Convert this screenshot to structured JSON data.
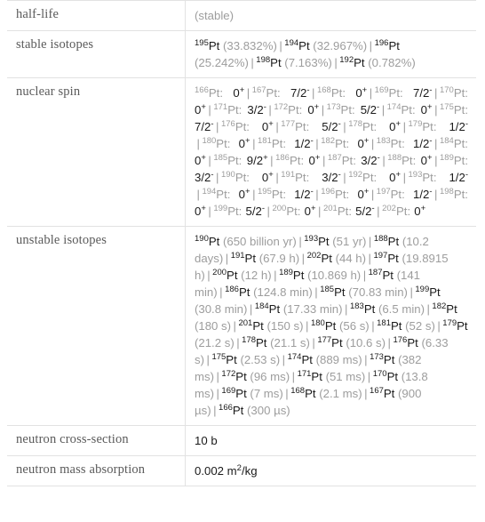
{
  "table": {
    "rows": [
      {
        "label": "half-life",
        "kind": "simple",
        "value": "(stable)",
        "value_style": "muted"
      },
      {
        "label": "stable isotopes",
        "kind": "isotope_list",
        "items": [
          {
            "mass": "195",
            "symbol": "Pt",
            "detail": "(33.832%)"
          },
          {
            "mass": "194",
            "symbol": "Pt",
            "detail": "(32.967%)"
          },
          {
            "mass": "196",
            "symbol": "Pt",
            "detail": "(25.242%)"
          },
          {
            "mass": "198",
            "symbol": "Pt",
            "detail": "(7.163%)"
          },
          {
            "mass": "192",
            "symbol": "Pt",
            "detail": "(0.782%)"
          }
        ]
      },
      {
        "label": "nuclear spin",
        "kind": "spin_list",
        "items": [
          {
            "mass": "166",
            "symbol": "Pt",
            "spin": "0",
            "spin_sup": "+"
          },
          {
            "mass": "167",
            "symbol": "Pt",
            "spin": "7/2",
            "spin_sup": "-"
          },
          {
            "mass": "168",
            "symbol": "Pt",
            "spin": "0",
            "spin_sup": "+"
          },
          {
            "mass": "169",
            "symbol": "Pt",
            "spin": "7/2",
            "spin_sup": "-"
          },
          {
            "mass": "170",
            "symbol": "Pt",
            "spin": "0",
            "spin_sup": "+"
          },
          {
            "mass": "171",
            "symbol": "Pt",
            "spin": "3/2",
            "spin_sup": "-"
          },
          {
            "mass": "172",
            "symbol": "Pt",
            "spin": "0",
            "spin_sup": "+"
          },
          {
            "mass": "173",
            "symbol": "Pt",
            "spin": "5/2",
            "spin_sup": "-"
          },
          {
            "mass": "174",
            "symbol": "Pt",
            "spin": "0",
            "spin_sup": "+"
          },
          {
            "mass": "175",
            "symbol": "Pt",
            "spin": "7/2",
            "spin_sup": "-"
          },
          {
            "mass": "176",
            "symbol": "Pt",
            "spin": "0",
            "spin_sup": "+"
          },
          {
            "mass": "177",
            "symbol": "Pt",
            "spin": "5/2",
            "spin_sup": "-"
          },
          {
            "mass": "178",
            "symbol": "Pt",
            "spin": "0",
            "spin_sup": "+"
          },
          {
            "mass": "179",
            "symbol": "Pt",
            "spin": "1/2",
            "spin_sup": "-"
          },
          {
            "mass": "180",
            "symbol": "Pt",
            "spin": "0",
            "spin_sup": "+"
          },
          {
            "mass": "181",
            "symbol": "Pt",
            "spin": "1/2",
            "spin_sup": "-"
          },
          {
            "mass": "182",
            "symbol": "Pt",
            "spin": "0",
            "spin_sup": "+"
          },
          {
            "mass": "183",
            "symbol": "Pt",
            "spin": "1/2",
            "spin_sup": "-"
          },
          {
            "mass": "184",
            "symbol": "Pt",
            "spin": "0",
            "spin_sup": "+"
          },
          {
            "mass": "185",
            "symbol": "Pt",
            "spin": "9/2",
            "spin_sup": "+"
          },
          {
            "mass": "186",
            "symbol": "Pt",
            "spin": "0",
            "spin_sup": "+"
          },
          {
            "mass": "187",
            "symbol": "Pt",
            "spin": "3/2",
            "spin_sup": "-"
          },
          {
            "mass": "188",
            "symbol": "Pt",
            "spin": "0",
            "spin_sup": "+"
          },
          {
            "mass": "189",
            "symbol": "Pt",
            "spin": "3/2",
            "spin_sup": "-"
          },
          {
            "mass": "190",
            "symbol": "Pt",
            "spin": "0",
            "spin_sup": "+"
          },
          {
            "mass": "191",
            "symbol": "Pt",
            "spin": "3/2",
            "spin_sup": "-"
          },
          {
            "mass": "192",
            "symbol": "Pt",
            "spin": "0",
            "spin_sup": "+"
          },
          {
            "mass": "193",
            "symbol": "Pt",
            "spin": "1/2",
            "spin_sup": "-"
          },
          {
            "mass": "194",
            "symbol": "Pt",
            "spin": "0",
            "spin_sup": "+"
          },
          {
            "mass": "195",
            "symbol": "Pt",
            "spin": "1/2",
            "spin_sup": "-"
          },
          {
            "mass": "196",
            "symbol": "Pt",
            "spin": "0",
            "spin_sup": "+"
          },
          {
            "mass": "197",
            "symbol": "Pt",
            "spin": "1/2",
            "spin_sup": "-"
          },
          {
            "mass": "198",
            "symbol": "Pt",
            "spin": "0",
            "spin_sup": "+"
          },
          {
            "mass": "199",
            "symbol": "Pt",
            "spin": "5/2",
            "spin_sup": "-"
          },
          {
            "mass": "200",
            "symbol": "Pt",
            "spin": "0",
            "spin_sup": "+"
          },
          {
            "mass": "201",
            "symbol": "Pt",
            "spin": "5/2",
            "spin_sup": "-"
          },
          {
            "mass": "202",
            "symbol": "Pt",
            "spin": "0",
            "spin_sup": "+"
          }
        ]
      },
      {
        "label": "unstable isotopes",
        "kind": "isotope_list",
        "items": [
          {
            "mass": "190",
            "symbol": "Pt",
            "detail": "(650 billion yr)"
          },
          {
            "mass": "193",
            "symbol": "Pt",
            "detail": "(51 yr)"
          },
          {
            "mass": "188",
            "symbol": "Pt",
            "detail": "(10.2 days)"
          },
          {
            "mass": "191",
            "symbol": "Pt",
            "detail": "(67.9 h)"
          },
          {
            "mass": "202",
            "symbol": "Pt",
            "detail": "(44 h)"
          },
          {
            "mass": "197",
            "symbol": "Pt",
            "detail": "(19.8915 h)"
          },
          {
            "mass": "200",
            "symbol": "Pt",
            "detail": "(12 h)"
          },
          {
            "mass": "189",
            "symbol": "Pt",
            "detail": "(10.869 h)"
          },
          {
            "mass": "187",
            "symbol": "Pt",
            "detail": "(141 min)"
          },
          {
            "mass": "186",
            "symbol": "Pt",
            "detail": "(124.8 min)"
          },
          {
            "mass": "185",
            "symbol": "Pt",
            "detail": "(70.83 min)"
          },
          {
            "mass": "199",
            "symbol": "Pt",
            "detail": "(30.8 min)"
          },
          {
            "mass": "184",
            "symbol": "Pt",
            "detail": "(17.33 min)"
          },
          {
            "mass": "183",
            "symbol": "Pt",
            "detail": "(6.5 min)"
          },
          {
            "mass": "182",
            "symbol": "Pt",
            "detail": "(180 s)"
          },
          {
            "mass": "201",
            "symbol": "Pt",
            "detail": "(150 s)"
          },
          {
            "mass": "180",
            "symbol": "Pt",
            "detail": "(56 s)"
          },
          {
            "mass": "181",
            "symbol": "Pt",
            "detail": "(52 s)"
          },
          {
            "mass": "179",
            "symbol": "Pt",
            "detail": "(21.2 s)"
          },
          {
            "mass": "178",
            "symbol": "Pt",
            "detail": "(21.1 s)"
          },
          {
            "mass": "177",
            "symbol": "Pt",
            "detail": "(10.6 s)"
          },
          {
            "mass": "176",
            "symbol": "Pt",
            "detail": "(6.33 s)"
          },
          {
            "mass": "175",
            "symbol": "Pt",
            "detail": "(2.53 s)"
          },
          {
            "mass": "174",
            "symbol": "Pt",
            "detail": "(889 ms)"
          },
          {
            "mass": "173",
            "symbol": "Pt",
            "detail": "(382 ms)"
          },
          {
            "mass": "172",
            "symbol": "Pt",
            "detail": "(96 ms)"
          },
          {
            "mass": "171",
            "symbol": "Pt",
            "detail": "(51 ms)"
          },
          {
            "mass": "170",
            "symbol": "Pt",
            "detail": "(13.8 ms)"
          },
          {
            "mass": "169",
            "symbol": "Pt",
            "detail": "(7 ms)"
          },
          {
            "mass": "168",
            "symbol": "Pt",
            "detail": "(2.1 ms)"
          },
          {
            "mass": "167",
            "symbol": "Pt",
            "detail": "(900 µs)"
          },
          {
            "mass": "166",
            "symbol": "Pt",
            "detail": "(300 µs)"
          }
        ]
      },
      {
        "label": "neutron cross-section",
        "kind": "simple",
        "value": "10 b",
        "value_style": "dark"
      },
      {
        "label": "neutron mass absorption",
        "kind": "unit_sup",
        "value_pre": "0.002 m",
        "value_sup": "2",
        "value_post": "/kg"
      }
    ],
    "separator": "|",
    "colors": {
      "border": "#e2e2e2",
      "label_text": "#5a5a5a",
      "value_dark": "#1a1a1a",
      "value_muted": "#9d9d9d",
      "background": "#ffffff"
    }
  }
}
